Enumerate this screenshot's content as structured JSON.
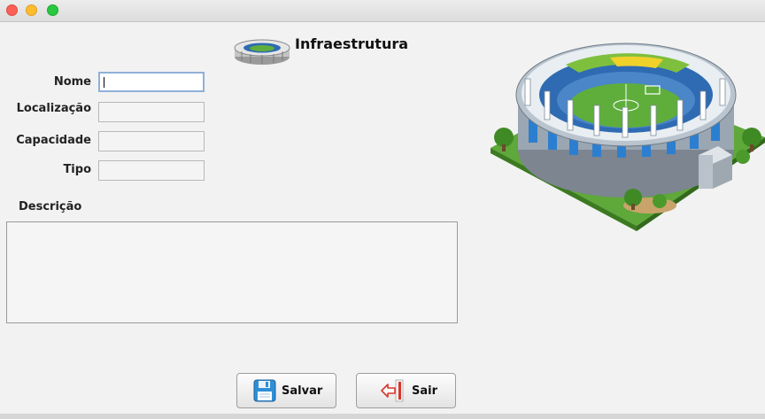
{
  "window": {
    "title": ""
  },
  "header": {
    "title": "Infraestrutura",
    "icon": "stadium-icon"
  },
  "form": {
    "nome": {
      "label": "Nome",
      "value": ""
    },
    "localizacao": {
      "label": "Localização",
      "value": ""
    },
    "capacidade": {
      "label": "Capacidade",
      "value": ""
    },
    "tipo": {
      "label": "Tipo",
      "value": ""
    },
    "descricao": {
      "label": "Descrição",
      "value": ""
    }
  },
  "buttons": {
    "save": {
      "label": "Salvar",
      "icon": "floppy-disk-icon"
    },
    "exit": {
      "label": "Sair",
      "icon": "exit-door-icon"
    }
  },
  "illustration": "stadium-illustration",
  "colors": {
    "accent_blue": "#2f8fd6",
    "pitch_green": "#5fae3c",
    "exit_red": "#d9342b"
  }
}
